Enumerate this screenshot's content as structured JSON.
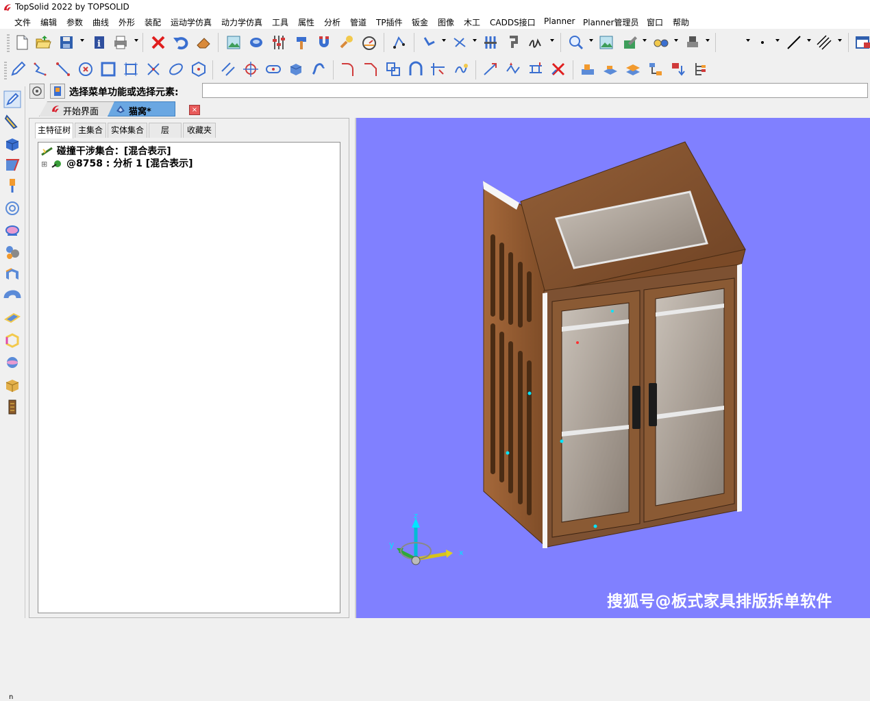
{
  "window": {
    "title": "TopSolid 2022 by TOPSOLID"
  },
  "menu": {
    "items": [
      "文件",
      "编辑",
      "参数",
      "曲线",
      "外形",
      "装配",
      "运动学仿真",
      "动力学仿真",
      "工具",
      "属性",
      "分析",
      "管道",
      "TP插件",
      "钣金",
      "图像",
      "木工",
      "CADDS接口",
      "Planner",
      "Planner管理员",
      "窗口",
      "帮助"
    ]
  },
  "toolbar1": {
    "icons": [
      "new-file-icon",
      "open-folder-icon",
      "save-icon",
      "info-icon",
      "print-icon",
      "delete-icon",
      "undo-icon",
      "eraser-icon",
      "image-icon",
      "cursor-icon",
      "sliders-icon",
      "hammer-icon",
      "magnet-icon",
      "tool-icon",
      "gauge-icon",
      "curve-tool-icon",
      "vector-icon",
      "constraint-icon",
      "equalizer-icon",
      "hook-icon",
      "signature-icon",
      "zoom-icon",
      "fit-view-icon",
      "layer-edit-icon",
      "glasses-icon",
      "render-icon",
      "dot-style-icon",
      "line-style-icon",
      "hatch-icon",
      "window-icon"
    ]
  },
  "toolbar2": {
    "icons": [
      "sketch-icon",
      "polyline-icon",
      "line-icon",
      "point-circle-icon",
      "rectangle-icon",
      "frame-icon",
      "trim-icon",
      "ellipse-icon",
      "polygon-icon",
      "parallel-icon",
      "center-point-icon",
      "slot-icon",
      "solid-box-icon",
      "offset-curve-icon",
      "fillet-icon",
      "chamfer-icon",
      "boolean-icon",
      "arch-icon",
      "corner-icon",
      "spline-icon",
      "extend-icon",
      "connect-icon",
      "project-icon",
      "delete-curve-icon",
      "layer-up-icon",
      "layer-flat-icon",
      "layer-stack-icon",
      "hierarchy-icon",
      "transform-icon",
      "tree-tool-icon"
    ]
  },
  "left_toolbar": {
    "icons": [
      "sketch-mode-icon",
      "pencil-tool-icon",
      "solid-cube-icon",
      "surface-icon",
      "drill-icon",
      "circle-target-icon",
      "rotate-icon",
      "assembly-icon",
      "sheet-fold-icon",
      "pipe-icon",
      "panel-icon",
      "frame-3d-icon",
      "sphere-icon",
      "box-icon",
      "cabinet-icon"
    ],
    "status": "n"
  },
  "command": {
    "prompt": "选择菜单功能或选择元素:",
    "value": ""
  },
  "doc_tabs": {
    "tabs": [
      "开始界面",
      "猫窝*"
    ],
    "close_glyph": "×"
  },
  "tree_panel": {
    "tabs": [
      "主特征树",
      "主集合",
      "实体集合",
      "层",
      "收藏夹"
    ],
    "expander": "⊞",
    "rows": [
      "碰撞干涉集合：[混合表示]",
      "@8758 : 分析 1 [混合表示]"
    ]
  },
  "viewport": {
    "background": "#8080ff",
    "axis_labels": {
      "z": "z",
      "y": "y",
      "x": "x"
    },
    "watermark": "搜狐号@板式家具排版拆单软件"
  }
}
